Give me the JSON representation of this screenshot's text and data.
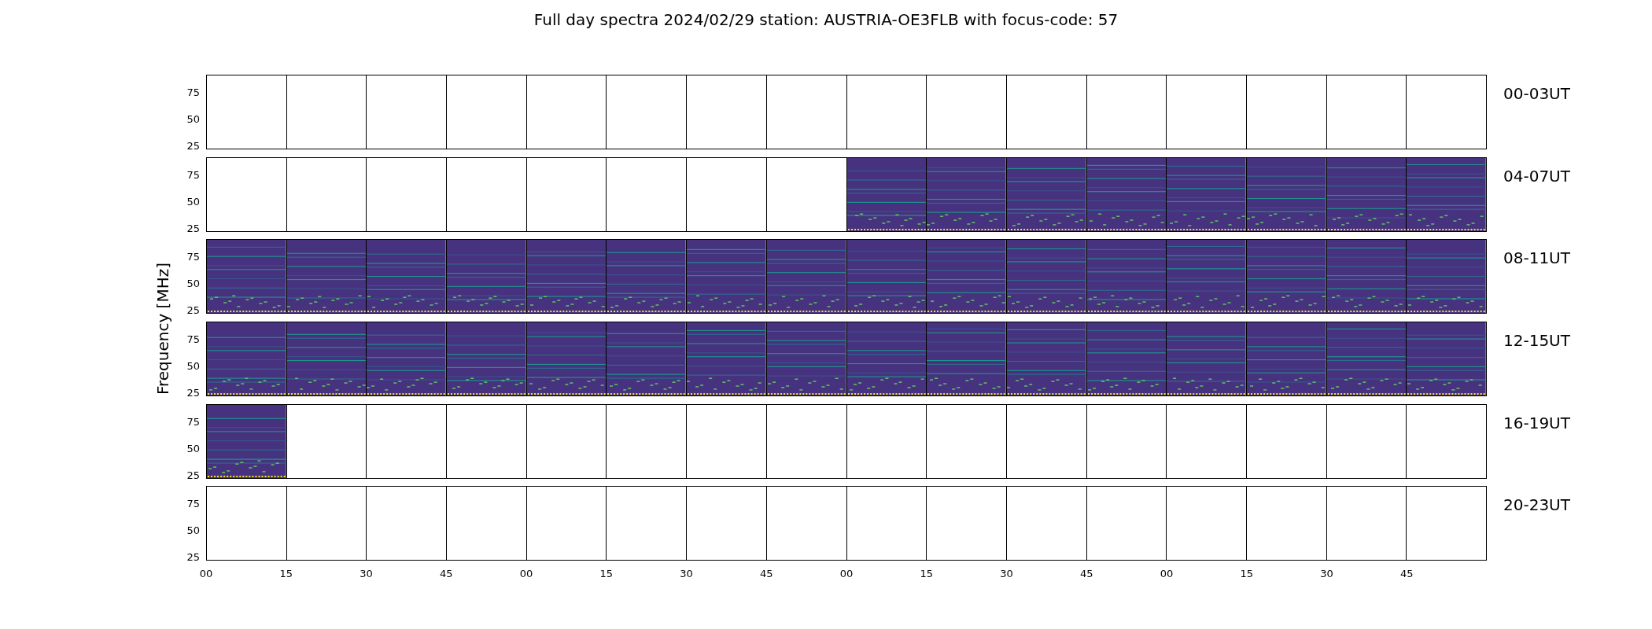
{
  "title": "Full day spectra 2024/02/29 station: AUSTRIA-OE3FLB with focus-code: 57",
  "ylabel": "Frequency [MHz]",
  "xticks": [
    "00",
    "15",
    "30",
    "45",
    "00",
    "15",
    "30",
    "45",
    "00",
    "15",
    "30",
    "45",
    "00",
    "15",
    "30",
    "45"
  ],
  "rows": [
    {
      "label": "00-03UT",
      "yticks": [
        "75",
        "50",
        "25"
      ],
      "panels": [
        {
          "filled": false
        },
        {
          "filled": false
        },
        {
          "filled": false
        },
        {
          "filled": false
        },
        {
          "filled": false
        },
        {
          "filled": false
        },
        {
          "filled": false
        },
        {
          "filled": false
        },
        {
          "filled": false
        },
        {
          "filled": false
        },
        {
          "filled": false
        },
        {
          "filled": false
        },
        {
          "filled": false
        },
        {
          "filled": false
        },
        {
          "filled": false
        },
        {
          "filled": false
        }
      ]
    },
    {
      "label": "04-07UT",
      "yticks": [
        "75",
        "50",
        "25"
      ],
      "panels": [
        {
          "filled": false
        },
        {
          "filled": false
        },
        {
          "filled": false
        },
        {
          "filled": false
        },
        {
          "filled": false
        },
        {
          "filled": false
        },
        {
          "filled": false
        },
        {
          "filled": false
        },
        {
          "filled": true
        },
        {
          "filled": true
        },
        {
          "filled": true
        },
        {
          "filled": true
        },
        {
          "filled": true
        },
        {
          "filled": true
        },
        {
          "filled": true
        },
        {
          "filled": true
        }
      ]
    },
    {
      "label": "08-11UT",
      "yticks": [
        "75",
        "50",
        "25"
      ],
      "panels": [
        {
          "filled": true
        },
        {
          "filled": true
        },
        {
          "filled": true
        },
        {
          "filled": true
        },
        {
          "filled": true
        },
        {
          "filled": true
        },
        {
          "filled": true
        },
        {
          "filled": true
        },
        {
          "filled": true
        },
        {
          "filled": true
        },
        {
          "filled": true
        },
        {
          "filled": true
        },
        {
          "filled": true
        },
        {
          "filled": true
        },
        {
          "filled": true
        },
        {
          "filled": true
        }
      ]
    },
    {
      "label": "12-15UT",
      "yticks": [
        "75",
        "50",
        "25"
      ],
      "panels": [
        {
          "filled": true
        },
        {
          "filled": true
        },
        {
          "filled": true
        },
        {
          "filled": true
        },
        {
          "filled": true
        },
        {
          "filled": true
        },
        {
          "filled": true
        },
        {
          "filled": true
        },
        {
          "filled": true
        },
        {
          "filled": true
        },
        {
          "filled": true
        },
        {
          "filled": true
        },
        {
          "filled": true
        },
        {
          "filled": true
        },
        {
          "filled": true
        },
        {
          "filled": true
        }
      ]
    },
    {
      "label": "16-19UT",
      "yticks": [
        "75",
        "50",
        "25"
      ],
      "panels": [
        {
          "filled": true
        },
        {
          "filled": false
        },
        {
          "filled": false
        },
        {
          "filled": false
        },
        {
          "filled": false
        },
        {
          "filled": false
        },
        {
          "filled": false
        },
        {
          "filled": false
        },
        {
          "filled": false
        },
        {
          "filled": false
        },
        {
          "filled": false
        },
        {
          "filled": false
        },
        {
          "filled": false
        },
        {
          "filled": false
        },
        {
          "filled": false
        },
        {
          "filled": false
        }
      ]
    },
    {
      "label": "20-23UT",
      "yticks": [
        "75",
        "50",
        "25"
      ],
      "panels": [
        {
          "filled": false
        },
        {
          "filled": false
        },
        {
          "filled": false
        },
        {
          "filled": false
        },
        {
          "filled": false
        },
        {
          "filled": false
        },
        {
          "filled": false
        },
        {
          "filled": false
        },
        {
          "filled": false
        },
        {
          "filled": false
        },
        {
          "filled": false
        },
        {
          "filled": false
        },
        {
          "filled": false
        },
        {
          "filled": false
        },
        {
          "filled": false
        },
        {
          "filled": false
        }
      ]
    }
  ]
}
